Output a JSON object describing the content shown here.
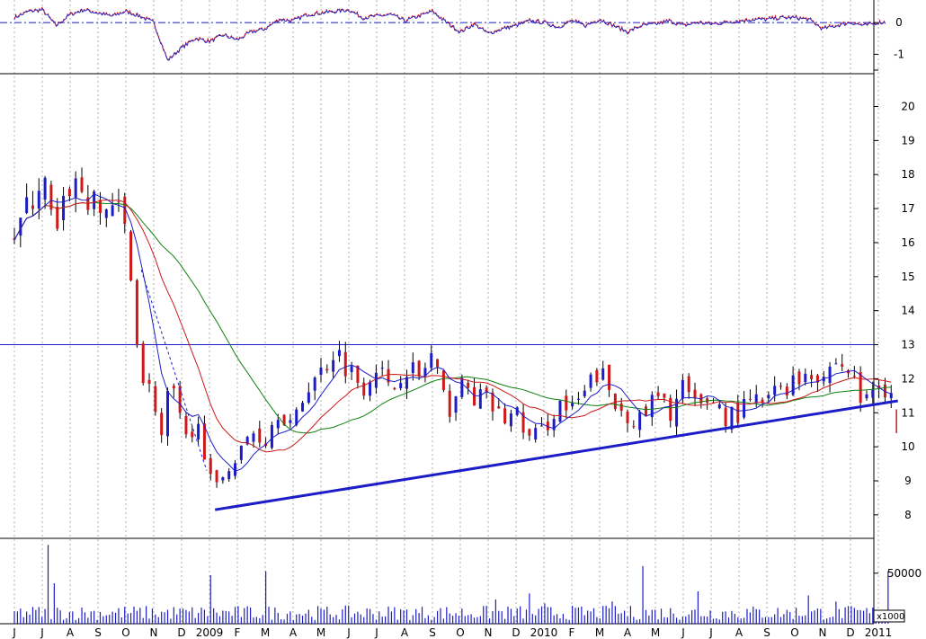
{
  "chart_data": [
    {
      "panel": "oscillator",
      "type": "line",
      "y_ticks": [
        "0",
        "-1"
      ],
      "ylim": [
        -1.5,
        0.6
      ],
      "zero_line": true,
      "colors": {
        "series_a": "#1d1dc8",
        "series_b": "#d01818",
        "zero_line": "#1d1dc8"
      },
      "x_month_index": [
        0,
        0.5,
        1,
        1.5,
        2,
        2.5,
        3,
        3.5,
        4,
        4.5,
        5,
        5.5,
        6,
        6.5,
        7,
        7.5,
        8,
        8.5,
        9,
        9.5,
        10,
        10.5,
        11,
        11.5,
        12,
        12.5,
        13,
        13.5,
        14,
        14.5,
        15,
        15.5,
        16,
        16.5,
        17,
        17.5,
        18,
        18.5,
        19,
        19.5,
        20,
        20.5,
        21,
        21.5,
        22,
        22.5,
        23,
        23.5,
        24,
        24.5,
        25,
        25.5,
        26,
        26.5,
        27,
        27.5,
        28,
        28.5,
        29,
        29.5,
        30,
        30.5,
        31
      ],
      "values": [
        0.15,
        0.35,
        0.4,
        -0.1,
        0.25,
        0.4,
        0.3,
        0.2,
        0.35,
        0.2,
        0.0,
        -1.2,
        -0.8,
        -0.5,
        -0.6,
        -0.4,
        -0.55,
        -0.3,
        -0.2,
        0.1,
        0.05,
        0.25,
        0.3,
        0.35,
        0.4,
        0.15,
        0.2,
        0.25,
        0.05,
        0.2,
        0.35,
        0.0,
        -0.3,
        -0.05,
        -0.35,
        -0.2,
        -0.1,
        0.05,
        0.0,
        -0.15,
        0.05,
        -0.1,
        0.1,
        -0.1,
        -0.3,
        -0.1,
        -0.05,
        0.05,
        -0.1,
        0.0,
        -0.05,
        0.0,
        0.05,
        0.1,
        0.1,
        0.15,
        0.15,
        0.1,
        -0.2,
        -0.1,
        0.0,
        -0.1,
        0.0
      ]
    },
    {
      "panel": "price",
      "type": "candlestick",
      "y_ticks": [
        8,
        9,
        10,
        11,
        12,
        13,
        14,
        15,
        16,
        17,
        18,
        19,
        20
      ],
      "ylim": [
        7.6,
        20.7
      ],
      "x_labels": [
        "J",
        "J",
        "A",
        "S",
        "O",
        "N",
        "D",
        "2009",
        "F",
        "M",
        "A",
        "M",
        "J",
        "J",
        "A",
        "S",
        "O",
        "N",
        "D",
        "2010",
        "F",
        "M",
        "A",
        "M",
        "J",
        "J",
        "A",
        "S",
        "O",
        "N",
        "D",
        "2011"
      ],
      "horizontal_line": 13.0,
      "trendline": {
        "from": [
          7.2,
          8.15
        ],
        "to": [
          31.7,
          11.35
        ]
      },
      "colors": {
        "up_candle": "#1d1dc8",
        "down_candle": "#d01818",
        "wick": "#000000",
        "ma_fast": "#1d1dc8",
        "ma_mid": "#d01818",
        "ma_slow": "#108010",
        "trendline": "#1d1dc8",
        "horizontal_line": "#1d1dc8",
        "grid": "#b0b0b0"
      },
      "close_key_points": {
        "month": [
          0,
          0.5,
          1,
          1.5,
          2,
          2.5,
          3,
          3.5,
          4,
          4.3,
          4.6,
          5,
          5.3,
          5.6,
          6,
          6.3,
          6.6,
          7,
          7.3,
          7.6,
          8,
          8.5,
          9,
          9.5,
          10,
          10.5,
          11,
          11.5,
          12,
          12.5,
          13,
          13.5,
          14,
          14.5,
          15,
          15.5,
          16,
          16.5,
          17,
          17.5,
          18,
          18.5,
          19,
          19.5,
          20,
          20.5,
          21,
          21.5,
          22,
          22.5,
          23,
          23.5,
          24,
          24.5,
          25,
          25.5,
          26,
          26.5,
          27,
          27.5,
          28,
          28.5,
          29,
          29.5,
          30,
          30.3,
          30.6,
          30.9,
          31,
          31.3,
          31.5
        ],
        "price": [
          16.3,
          17.0,
          18.0,
          16.0,
          17.8,
          17.5,
          16.8,
          17.2,
          16.3,
          14.0,
          12.0,
          11.5,
          10.2,
          12.0,
          10.5,
          9.8,
          11.0,
          9.0,
          8.7,
          9.5,
          9.6,
          10.5,
          10.2,
          11.2,
          10.5,
          11.8,
          12.2,
          12.9,
          12.3,
          11.8,
          12.5,
          11.5,
          12.5,
          12.0,
          12.7,
          11.0,
          11.8,
          11.5,
          11.3,
          10.8,
          11.0,
          10.2,
          10.5,
          11.3,
          11.0,
          11.6,
          12.3,
          11.2,
          11.0,
          10.7,
          11.5,
          11.0,
          11.8,
          11.0,
          11.5,
          10.9,
          11.0,
          11.3,
          11.3,
          11.8,
          11.9,
          12.3,
          12.1,
          12.5,
          12.2,
          11.5,
          11.3,
          11.9,
          11.8,
          11.75,
          11.7
        ]
      },
      "last_candle": {
        "month": 31.65,
        "open": 11.0,
        "close": 10.5,
        "high": 11.1,
        "low": 10.4
      }
    },
    {
      "panel": "volume",
      "type": "bar",
      "y_ticks": [
        "50000"
      ],
      "unit_label": "x1000",
      "ylim": [
        0,
        80000
      ],
      "bar_color": "#1d1dc8",
      "typical_volume": 12000,
      "spikes": {
        "month": [
          1.2,
          1.4,
          7.0,
          9.0,
          17.3,
          18.5,
          19.0,
          21.5,
          22.5,
          24.5,
          28.5,
          29.5,
          31.4
        ],
        "value": [
          78000,
          40000,
          48000,
          52000,
          24000,
          30000,
          20000,
          22000,
          57000,
          32000,
          28000,
          22000,
          52000
        ]
      }
    }
  ]
}
